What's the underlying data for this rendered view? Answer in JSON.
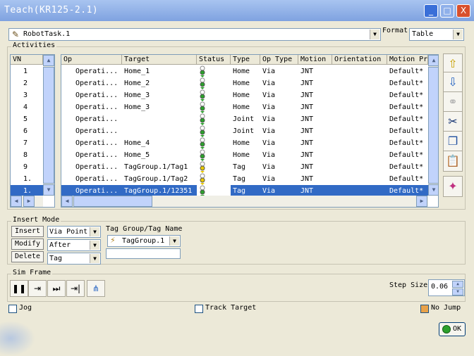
{
  "window": {
    "title": "Teach(KR125-2.1)",
    "min_label": "_",
    "max_label": "□",
    "close_label": "X"
  },
  "task": {
    "value": "RobotTask.1",
    "format_label": "Format",
    "format_value": "Table"
  },
  "activities": {
    "label": "Activities",
    "vn_header": "VN",
    "vn_values": [
      "1",
      "2",
      "3",
      "4",
      "5",
      "6",
      "7",
      "8",
      "9",
      "1.",
      "1."
    ],
    "columns": [
      "Op",
      "Target",
      "Status",
      "Type",
      "Op Type",
      "Motion",
      "Orientation",
      "Motion Pr"
    ],
    "rows": [
      {
        "op": "Operati...",
        "target": "Home_1",
        "type": "Home",
        "optype": "Via",
        "motion": "JNT",
        "profile": "Default*",
        "status": "green"
      },
      {
        "op": "Operati...",
        "target": "Home_2",
        "type": "Home",
        "optype": "Via",
        "motion": "JNT",
        "profile": "Default*",
        "status": "green"
      },
      {
        "op": "Operati...",
        "target": "Home_3",
        "type": "Home",
        "optype": "Via",
        "motion": "JNT",
        "profile": "Default*",
        "status": "green"
      },
      {
        "op": "Operati...",
        "target": "Home_3",
        "type": "Home",
        "optype": "Via",
        "motion": "JNT",
        "profile": "Default*",
        "status": "green"
      },
      {
        "op": "Operati...",
        "target": "",
        "type": "Joint",
        "optype": "Via",
        "motion": "JNT",
        "profile": "Default*",
        "status": "green"
      },
      {
        "op": "Operati...",
        "target": "",
        "type": "Joint",
        "optype": "Via",
        "motion": "JNT",
        "profile": "Default*",
        "status": "green"
      },
      {
        "op": "Operati...",
        "target": "Home_4",
        "type": "Home",
        "optype": "Via",
        "motion": "JNT",
        "profile": "Default*",
        "status": "green"
      },
      {
        "op": "Operati...",
        "target": "Home_5",
        "type": "Home",
        "optype": "Via",
        "motion": "JNT",
        "profile": "Default*",
        "status": "green"
      },
      {
        "op": "Operati...",
        "target": "TagGroup.1/Tag1",
        "type": "Tag",
        "optype": "Via",
        "motion": "JNT",
        "profile": "Default*",
        "status": "yellow"
      },
      {
        "op": "Operati...",
        "target": "TagGroup.1/Tag2",
        "type": "Tag",
        "optype": "Via",
        "motion": "JNT",
        "profile": "Default*",
        "status": "yellow"
      },
      {
        "op": "Operati...",
        "target": "TagGroup.1/12351",
        "type": "Tag",
        "optype": "Via",
        "motion": "JNT",
        "profile": "Default*",
        "status": "green"
      }
    ],
    "selected_index": 10
  },
  "tools": {
    "move_up": "up-arrow-icon",
    "move_down": "down-arrow-icon",
    "link": "link-icon",
    "cut": "scissors-icon",
    "copy": "copy-icon",
    "paste": "paste-icon",
    "action": "action-icon"
  },
  "insert_mode": {
    "label": "Insert Mode",
    "insert_label": "Insert",
    "modify_label": "Modify",
    "delete_label": "Delete",
    "point_value": "Via Point",
    "position_value": "After",
    "kind_value": "Tag",
    "tag_group_label": "Tag Group/Tag Name",
    "tag_group_value": "TagGroup.1",
    "tag_name_value": ""
  },
  "sim_frame": {
    "label": "Sim Frame",
    "step_size_label": "Step Size",
    "step_size_value": "0.06"
  },
  "options": {
    "jog_label": "Jog",
    "track_target_label": "Track Target",
    "no_jump_label": "No Jump",
    "ok_label": "OK"
  },
  "colors": {
    "selection": "#316ac5",
    "title_gradient_top": "#a8c4f0",
    "status_green": "#2ca02c",
    "status_yellow": "#e8c800"
  }
}
